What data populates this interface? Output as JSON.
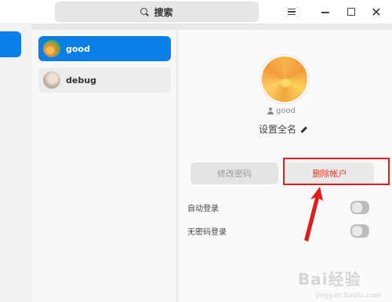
{
  "search": {
    "label": "搜索"
  },
  "users": [
    {
      "name": "good",
      "active": true
    },
    {
      "name": "debug",
      "active": false
    }
  ],
  "detail": {
    "account_name": "good",
    "set_fullname": "设置全名",
    "change_password": "修改密码",
    "delete_account": "删除帐户"
  },
  "settings": [
    {
      "label": "自动登录",
      "enabled": false
    },
    {
      "label": "无密码登录",
      "enabled": false
    }
  ],
  "watermark": {
    "text": "Bai经验",
    "sub": "jingyan.baidu.com"
  },
  "colors": {
    "accent": "#0a7fe8",
    "danger": "#e23a2a",
    "highlight": "#e21b1b"
  }
}
